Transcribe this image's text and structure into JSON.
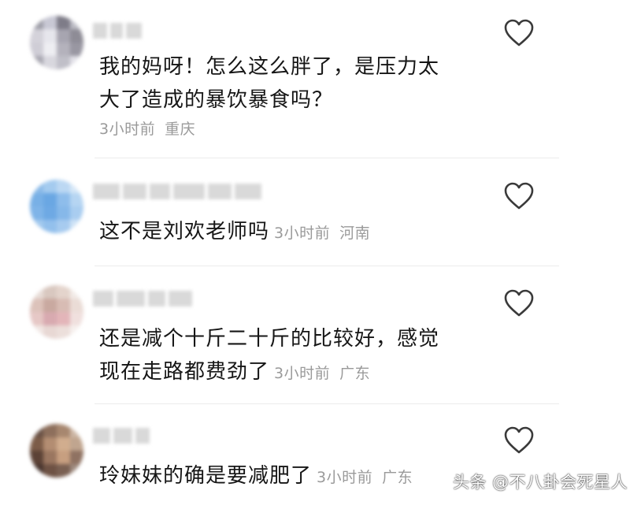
{
  "comments": [
    {
      "text_lines": [
        "我的妈呀！怎么这么胖了，是压力太",
        "大了造成的暴饮暴食吗？"
      ],
      "time": "3小时前",
      "location": "重庆",
      "colors": [
        "#9e9ea8",
        "#c8c8d4",
        "#7e7c88",
        "#bdbdc6",
        "#d4d2da",
        "#e6e6ec",
        "#a7a5b0",
        "#8e8c96",
        "#cfcdd6",
        "#eeeef2",
        "#b4b2bc",
        "#9997a2",
        "#a9a8b2",
        "#d8d7de",
        "#c0bfc8",
        "#e2e1e8"
      ]
    },
    {
      "text_lines": [
        "这不是刘欢老师吗"
      ],
      "time": "3小时前",
      "location": "河南",
      "colors": [
        "#8cbbe8",
        "#a4cbef",
        "#bcd8f3",
        "#d6e7f7",
        "#78b0e6",
        "#6aa7e3",
        "#8ebdeb",
        "#b6d5f2",
        "#7fb4e8",
        "#6ea9e4",
        "#86b8e9",
        "#a9cdf0",
        "#a3c9ee",
        "#93c0ec",
        "#a7cbef",
        "#cfe3f6"
      ]
    },
    {
      "text_lines": [
        "还是减个十斤二十斤的比较好，感觉",
        "现在走路都费劲了"
      ],
      "time": "3小时前",
      "location": "广东",
      "colors": [
        "#e8ddd8",
        "#d9c8c0",
        "#e4d4cc",
        "#f2ebe7",
        "#dcc2ba",
        "#c9a9a0",
        "#d8bcb4",
        "#eadcd6",
        "#e6c8c6",
        "#d8aab0",
        "#e3b5b9",
        "#f0e0de",
        "#f1e7e4",
        "#e8d8d4",
        "#ecdfdb",
        "#f6f0ee"
      ]
    },
    {
      "text_lines": [
        "玲妹妹的确是要减肥了"
      ],
      "time": "3小时前",
      "location": "广东",
      "colors": [
        "#6a5246",
        "#8d6f5c",
        "#a7876f",
        "#cdb7a5",
        "#7c5c48",
        "#b38d72",
        "#d1ad8e",
        "#c0a58f",
        "#5c4236",
        "#9a7660",
        "#c79f80",
        "#8f7262",
        "#4a3730",
        "#6e5244",
        "#7a6052",
        "#9e8a7e"
      ]
    }
  ],
  "watermark": "头条 @不八卦会死星人",
  "icons": {
    "like": "heart-outline-icon"
  }
}
